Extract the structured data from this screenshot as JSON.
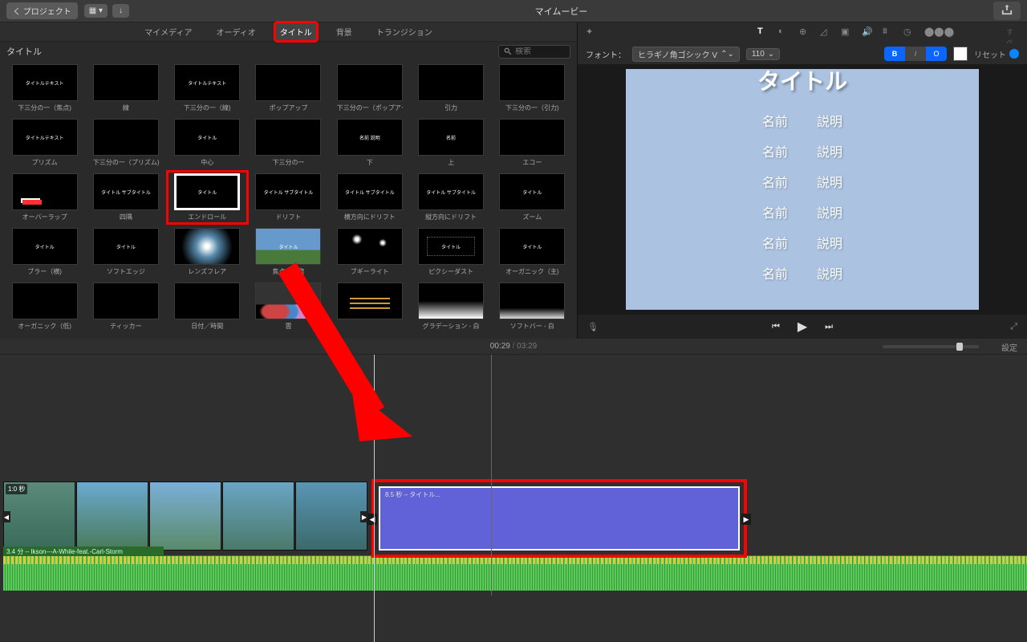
{
  "toolbar": {
    "back": "く プロジェクト",
    "title": "マイムービー"
  },
  "media_tabs": [
    "マイメディア",
    "オーディオ",
    "タイトル",
    "背景",
    "トランジション"
  ],
  "active_tab_index": 2,
  "browser": {
    "label": "タイトル",
    "search_placeholder": "検索"
  },
  "titles": [
    {
      "label": "下三分の一（焦点)",
      "txt": "タイトルテキスト"
    },
    {
      "label": "線",
      "txt": ""
    },
    {
      "label": "下三分の一（線)",
      "txt": "タイトルテキスト"
    },
    {
      "label": "ポップアップ",
      "txt": ""
    },
    {
      "label": "下三分の一（ポップアップ)",
      "txt": ""
    },
    {
      "label": "引力",
      "txt": ""
    },
    {
      "label": "下三分の一（引力)",
      "txt": ""
    },
    {
      "label": "プリズム",
      "txt": "タイトルテキスト"
    },
    {
      "label": "下三分の一（プリズム)",
      "txt": ""
    },
    {
      "label": "中心",
      "txt": "タイトル"
    },
    {
      "label": "下三分の一",
      "txt": ""
    },
    {
      "label": "下",
      "txt": "名前 説明"
    },
    {
      "label": "上",
      "txt": "名前"
    },
    {
      "label": "エコー",
      "txt": ""
    },
    {
      "label": "オーバーラップ",
      "txt": "",
      "cls": "overlap"
    },
    {
      "label": "四隅",
      "txt": "タイトル サブタイトル"
    },
    {
      "label": "エンドロール",
      "txt": "タイトル",
      "cls": "selected",
      "hl": true
    },
    {
      "label": "ドリフト",
      "txt": "タイトル サブタイトル"
    },
    {
      "label": "横方向にドリフト",
      "txt": "タイトル サブタイトル"
    },
    {
      "label": "縦方向にドリフト",
      "txt": "タイトル サブタイトル"
    },
    {
      "label": "ズーム",
      "txt": "タイトル"
    },
    {
      "label": "ブラー（横)",
      "txt": "タイトル"
    },
    {
      "label": "ソフトエッジ",
      "txt": "タイトル"
    },
    {
      "label": "レンズフレア",
      "txt": "",
      "cls": "flare"
    },
    {
      "label": "焦点を調整",
      "txt": "タイトル",
      "cls": "landscape"
    },
    {
      "label": "ブギーライト",
      "txt": "",
      "cls": "spark"
    },
    {
      "label": "ピクシーダスト",
      "txt": "タイトル",
      "cls": "pixie"
    },
    {
      "label": "オーガニック（主)",
      "txt": "タイトル"
    },
    {
      "label": "オーガニック（低)",
      "txt": ""
    },
    {
      "label": "ティッカー",
      "txt": ""
    },
    {
      "label": "日付／時間",
      "txt": ""
    },
    {
      "label": "雲",
      "txt": "",
      "cls": "clouds"
    },
    {
      "label": "",
      "txt": "",
      "cls": "yellow-lines"
    },
    {
      "label": "グラデーション - 白",
      "txt": "",
      "cls": "grad-w"
    },
    {
      "label": "ソフトバー - 白",
      "txt": "",
      "cls": "soft-w"
    }
  ],
  "font_bar": {
    "label": "フォント：",
    "font": "ヒラギノ角ゴシック V",
    "size": "110",
    "b": "B",
    "i": "I",
    "o": "O",
    "reset": "リセット"
  },
  "preview": {
    "title": "タイトル",
    "rows": [
      [
        "名前",
        "説明"
      ],
      [
        "名前",
        "説明"
      ],
      [
        "名前",
        "説明"
      ],
      [
        "名前",
        "説明"
      ],
      [
        "名前",
        "説明"
      ],
      [
        "名前",
        "説明"
      ]
    ]
  },
  "playhead": {
    "current": "00:29",
    "total": "03:29"
  },
  "timeline": {
    "settings": "設定",
    "clip_duration": "1:0 秒",
    "title_clip_label": "8.5 秒 – タイトル...",
    "audio_label": "3.4 分 – Ikson---A-While-feat.-Carl-Storm"
  }
}
